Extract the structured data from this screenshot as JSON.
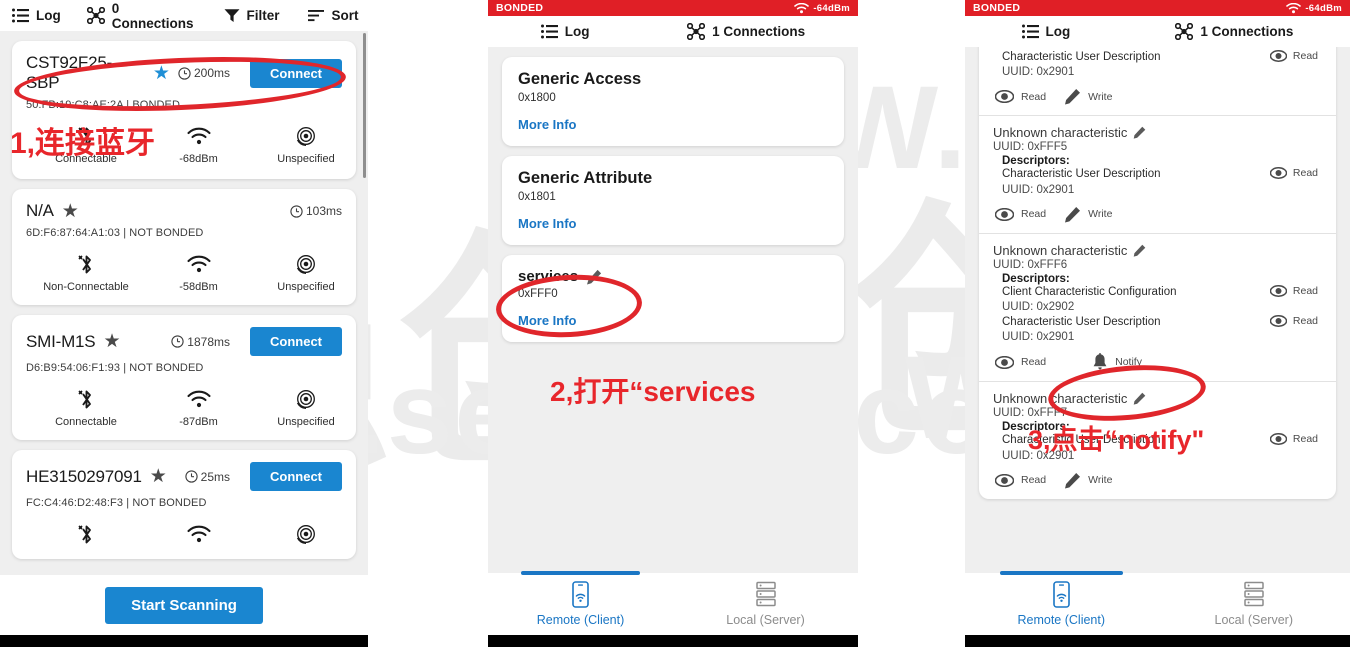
{
  "left_panel": {
    "toolbar": [
      {
        "icon": "log-list-icon",
        "label": "Log"
      },
      {
        "icon": "connections-node-icon",
        "label": "0 Connections"
      },
      {
        "icon": "filter-funnel-icon",
        "label": "Filter"
      },
      {
        "icon": "sort-icon",
        "label": "Sort"
      }
    ],
    "devices": [
      {
        "name": "CST92F25-SBP",
        "favorite": true,
        "latency": "200ms",
        "action": "Connect",
        "mac": "50:FB:19:C8:AE:2A | BONDED",
        "connectable": "Connectable",
        "rssi": "-68dBm",
        "advertising": "Unspecified"
      },
      {
        "name": "N/A",
        "favorite": false,
        "latency": "103ms",
        "action": "",
        "mac": "6D:F6:87:64:A1:03 | NOT BONDED",
        "connectable": "Non-Connectable",
        "rssi": "-58dBm",
        "advertising": "Unspecified"
      },
      {
        "name": "SMI-M1S",
        "favorite": false,
        "latency": "1878ms",
        "action": "Connect",
        "mac": "D6:B9:54:06:F1:93 | NOT BONDED",
        "connectable": "Connectable",
        "rssi": "-87dBm",
        "advertising": "Unspecified"
      },
      {
        "name": "HE3150297091",
        "favorite": false,
        "latency": "25ms",
        "action": "Connect",
        "mac": "FC:C4:46:D2:48:F3 | NOT BONDED",
        "connectable": "",
        "rssi": "",
        "advertising": ""
      }
    ],
    "scan_button": "Start Scanning"
  },
  "middle_panel": {
    "status": {
      "bonded": "BONDED",
      "rssi": "-64dBm"
    },
    "toolbar": [
      {
        "icon": "log-list-icon",
        "label": "Log"
      },
      {
        "icon": "connections-node-icon",
        "label": "1 Connections"
      }
    ],
    "services": [
      {
        "name": "Generic Access",
        "uuid": "0x1800",
        "more": "More Info",
        "editable": false
      },
      {
        "name": "Generic Attribute",
        "uuid": "0x1801",
        "more": "More Info",
        "editable": false
      },
      {
        "name": "services",
        "uuid": "0xFFF0",
        "more": "More Info",
        "editable": true
      }
    ],
    "bottom_nav": [
      {
        "icon": "phone-remote-icon",
        "label": "Remote (Client)",
        "active": true
      },
      {
        "icon": "server-stack-icon",
        "label": "Local (Server)",
        "active": false
      }
    ]
  },
  "right_panel": {
    "status": {
      "bonded": "BONDED",
      "rssi": "-64dBm"
    },
    "toolbar": [
      {
        "icon": "log-list-icon",
        "label": "Log"
      },
      {
        "icon": "connections-node-icon",
        "label": "1 Connections"
      }
    ],
    "characteristics": [
      {
        "title": "",
        "uuid": "",
        "descriptors_label": "",
        "descriptors": [
          {
            "name": "Characteristic User Description",
            "uuid": "UUID: 0x2901",
            "action": "Read"
          }
        ],
        "actions": [
          "Read",
          "Write"
        ],
        "clipped_top": true
      },
      {
        "title": "Unknown characteristic",
        "uuid": "UUID: 0xFFF5",
        "descriptors_label": "Descriptors:",
        "descriptors": [
          {
            "name": "Characteristic User Description",
            "uuid": "UUID: 0x2901",
            "action": "Read"
          }
        ],
        "actions": [
          "Read",
          "Write"
        ],
        "clipped_top": false
      },
      {
        "title": "Unknown characteristic",
        "uuid": "UUID: 0xFFF6",
        "descriptors_label": "Descriptors:",
        "descriptors": [
          {
            "name": "Client Characteristic Configuration",
            "uuid": "UUID: 0x2902",
            "action": "Read"
          },
          {
            "name": "Characteristic User Description",
            "uuid": "UUID: 0x2901",
            "action": "Read"
          }
        ],
        "actions": [
          "Read",
          "Notify"
        ],
        "clipped_top": false
      },
      {
        "title": "Unknown characteristic",
        "uuid": "UUID: 0xFFF7",
        "descriptors_label": "Descriptors:",
        "descriptors": [
          {
            "name": "Characteristic User Description",
            "uuid": "UUID: 0x2901",
            "action": "Read"
          }
        ],
        "actions": [
          "Read",
          "Write"
        ],
        "clipped_top": false
      }
    ],
    "bottom_nav": [
      {
        "icon": "phone-remote-icon",
        "label": "Remote (Client)",
        "active": true
      },
      {
        "icon": "server-stack-icon",
        "label": "Local (Server)",
        "active": false
      }
    ]
  },
  "annotations": [
    {
      "id": "step1",
      "text": "1,连接蓝牙"
    },
    {
      "id": "step2",
      "text": "2,打开“services"
    },
    {
      "id": "step3",
      "text": "3,点击“notify\""
    }
  ],
  "watermark": {
    "cjk": "强创",
    "url1": "WWW.",
    "url2": "www.sekorm.com"
  },
  "colors": {
    "accent_blue": "#1a86d0",
    "link_blue": "#1a76c4",
    "status_red": "#e01f26",
    "annotation_red": "#e8262b",
    "panel_bg": "#efefef"
  }
}
